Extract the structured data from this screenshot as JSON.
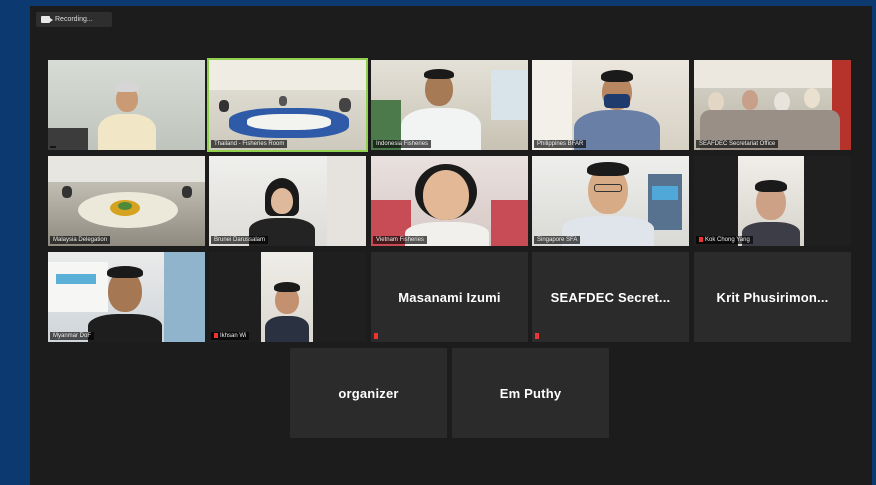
{
  "recording": {
    "label": "Recording..."
  },
  "participants": [
    {
      "id": "p1",
      "name": ""
    },
    {
      "id": "p2",
      "name": "Thailand - Fisheries Room"
    },
    {
      "id": "p3",
      "name": "Indonesia Fisheries"
    },
    {
      "id": "p4",
      "name": "Philippines BFAR"
    },
    {
      "id": "p5",
      "name": "SEAFDEC Secretariat Office"
    },
    {
      "id": "p6",
      "name": "Malaysia Delegation"
    },
    {
      "id": "p7",
      "name": "Brunei Darussalam"
    },
    {
      "id": "p8",
      "name": "Vietnam Fisheries"
    },
    {
      "id": "p9",
      "name": "Singapore SFA"
    },
    {
      "id": "p10",
      "name": "Kok Chong Yang"
    },
    {
      "id": "p11",
      "name": "Myanmar DoF"
    },
    {
      "id": "p12",
      "name": "Ikhsan Wi"
    },
    {
      "id": "p13",
      "name": "Masanami Izumi"
    },
    {
      "id": "p14",
      "name": "SEAFDEC  Secret..."
    },
    {
      "id": "p15",
      "name": "Krit  Phusirimon..."
    },
    {
      "id": "p16",
      "name": "organizer"
    },
    {
      "id": "p17",
      "name": "Em Puthy"
    }
  ]
}
